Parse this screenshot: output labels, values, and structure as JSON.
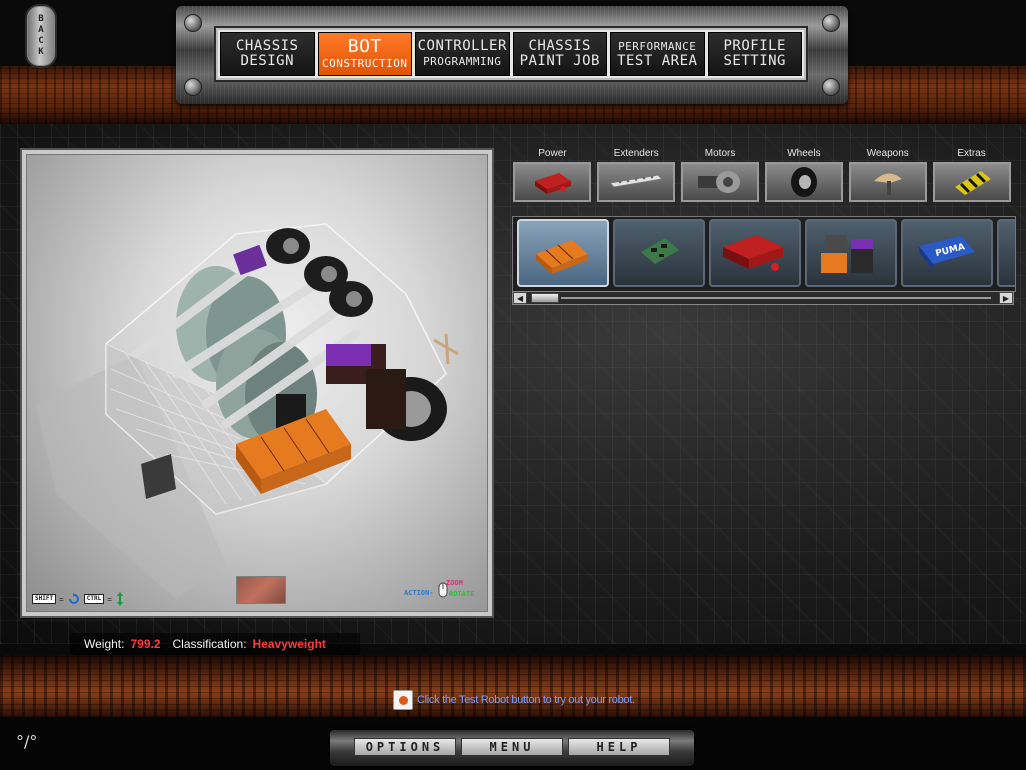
{
  "back_button": {
    "label": "BACK"
  },
  "nav": {
    "tabs": [
      {
        "line1": "CHASSIS",
        "line2": "DESIGN",
        "active": false
      },
      {
        "line1": "BOT",
        "line2": "CONSTRUCTION",
        "active": true
      },
      {
        "line1": "CONTROLLER",
        "line2": "PROGRAMMING",
        "active": false
      },
      {
        "line1": "CHASSIS",
        "line2": "PAINT JOB",
        "active": false
      },
      {
        "line1": "PERFORMANCE",
        "line2": "TEST AREA",
        "active": false
      },
      {
        "line1": "PROFILE",
        "line2": "SETTING",
        "active": false
      }
    ]
  },
  "viewport": {
    "shift_key": "SHIFT",
    "ctrl_key": "CTRL",
    "action_label": "ACTION-",
    "zoom_label": "ZOOM",
    "rotate_label": "ROTATE"
  },
  "parts_panel": {
    "categories": [
      {
        "label": "Power",
        "icon": "battery-icon"
      },
      {
        "label": "Extenders",
        "icon": "extender-bar-icon"
      },
      {
        "label": "Motors",
        "icon": "motor-icon"
      },
      {
        "label": "Wheels",
        "icon": "wheel-icon"
      },
      {
        "label": "Weapons",
        "icon": "weapon-icon"
      },
      {
        "label": "Extras",
        "icon": "extras-icon"
      }
    ],
    "items": [
      {
        "icon": "battery-pack-orange-icon",
        "selected": true
      },
      {
        "icon": "circuit-board-icon",
        "selected": false
      },
      {
        "icon": "red-battery-icon",
        "selected": false
      },
      {
        "icon": "battery-stack-icon",
        "selected": false
      },
      {
        "icon": "puma-battery-icon",
        "selected": false
      }
    ]
  },
  "stats": {
    "weight_label": "Weight:",
    "weight_value": "799.2",
    "class_label": "Classification:",
    "class_value": "Heavyweight"
  },
  "tip": {
    "text": "Click the Test Robot button to try out your robot."
  },
  "menu": {
    "options": "OPTIONS",
    "menu": "MENU",
    "help": "HELP"
  },
  "colors": {
    "accent_orange": "#f26a1b",
    "stat_red": "#ff3a3a",
    "tip_blue": "#7ea0ff"
  }
}
